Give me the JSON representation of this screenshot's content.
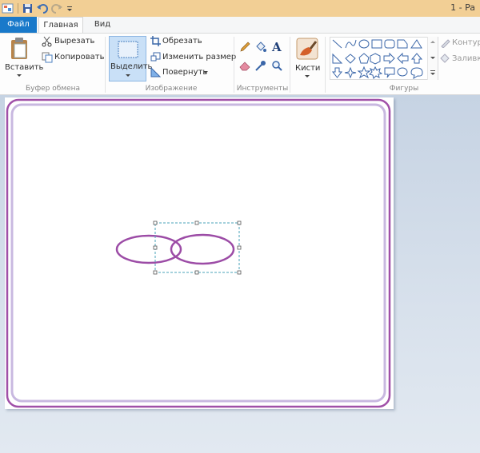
{
  "window": {
    "title": "1 - Pa"
  },
  "tabs": {
    "file": "Файл",
    "home": "Главная",
    "view": "Вид"
  },
  "clipboard": {
    "paste": "Вставить",
    "cut": "Вырезать",
    "copy": "Копировать",
    "group_label": "Буфер обмена"
  },
  "image": {
    "select": "Выделить",
    "crop": "Обрезать",
    "resize": "Изменить размер",
    "rotate": "Повернуть",
    "group_label": "Изображение"
  },
  "tools": {
    "group_label": "Инструменты"
  },
  "brushes": {
    "label": "Кисти"
  },
  "shapes": {
    "group_label": "Фигуры",
    "outline": "Контур",
    "fill": "Заливк"
  },
  "colors": {
    "accent": "#1979ca",
    "titlebar": "#f2cf95",
    "frame_outer": "#a050a8",
    "frame_inner": "#c8b8e0",
    "ellipse_stroke": "#9c4ca6",
    "selection": "#4aa3b8"
  }
}
